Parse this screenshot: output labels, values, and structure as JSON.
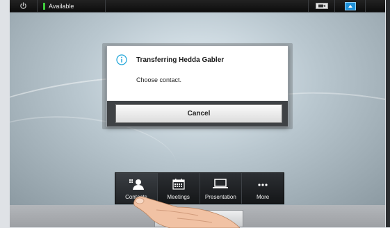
{
  "status_bar": {
    "presence": "Available"
  },
  "dialog": {
    "title": "Transferring Hedda Gabler",
    "subtitle": "Choose contact.",
    "cancel_label": "Cancel"
  },
  "toolbar": {
    "items": [
      {
        "label": "Contacts",
        "icon": "contacts-icon"
      },
      {
        "label": "Meetings",
        "icon": "calendar-icon"
      },
      {
        "label": "Presentation",
        "icon": "laptop-icon"
      },
      {
        "label": "More",
        "icon": "more-icon"
      }
    ]
  },
  "colors": {
    "presence_green": "#3ecb3c",
    "toolbar_bg": "#1c1e21"
  }
}
